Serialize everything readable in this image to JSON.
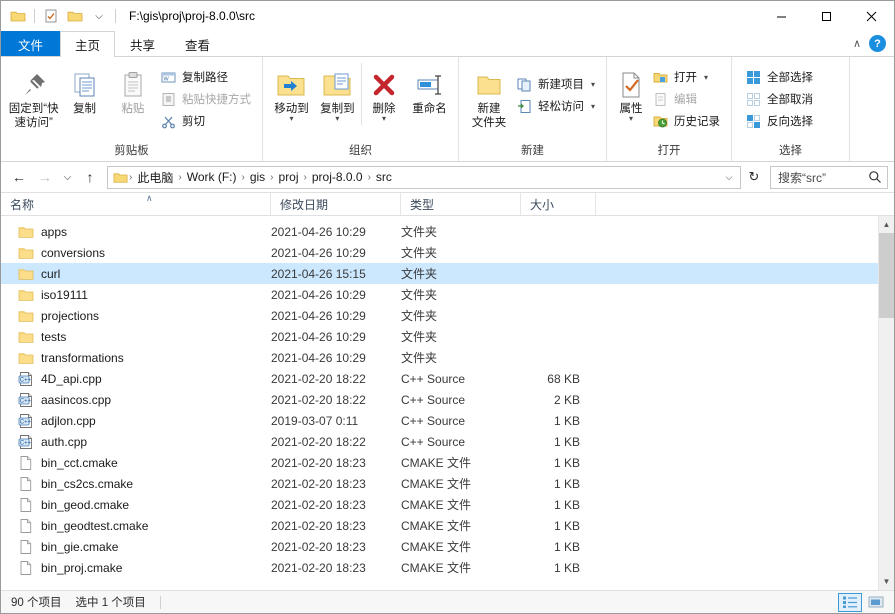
{
  "window": {
    "title": "F:\\gis\\proj\\proj-8.0.0\\src",
    "minimize_label": "—",
    "maximize_label": "☐",
    "close_label": "✕"
  },
  "quick_access": {
    "folder_icon": "folder-icon",
    "properties_icon": "properties-icon",
    "new_folder_icon": "new-folder-icon",
    "dropdown_label": "⌵"
  },
  "ribbon": {
    "tabs": [
      {
        "label": "文件",
        "kind": "file"
      },
      {
        "label": "主页",
        "kind": "active"
      },
      {
        "label": "共享",
        "kind": "normal"
      },
      {
        "label": "查看",
        "kind": "normal"
      }
    ],
    "collapse_label": "∧",
    "help_label": "?",
    "groups": {
      "clipboard": {
        "title": "剪贴板",
        "pin": "固定到“快速访问”",
        "copy": "复制",
        "paste": "粘贴",
        "copy_path": "复制路径",
        "paste_shortcut": "粘贴快捷方式",
        "cut": "剪切"
      },
      "organize": {
        "title": "组织",
        "move_to": "移动到",
        "copy_to": "复制到",
        "delete": "删除",
        "rename": "重命名"
      },
      "new": {
        "title": "新建",
        "new_folder_line1": "新建",
        "new_folder_line2": "文件夹",
        "new_item": "新建项目",
        "easy_access": "轻松访问"
      },
      "open": {
        "title": "打开",
        "properties": "属性",
        "open": "打开",
        "edit": "编辑",
        "history": "历史记录"
      },
      "select": {
        "title": "选择",
        "select_all": "全部选择",
        "select_none": "全部取消",
        "invert": "反向选择"
      }
    }
  },
  "nav": {
    "back": "←",
    "forward": "→",
    "recent": "⌵",
    "up": "↑",
    "refresh": "↻",
    "dropdown": "⌵"
  },
  "breadcrumb": {
    "separator": "›",
    "items": [
      "此电脑",
      "Work (F:)",
      "gis",
      "proj",
      "proj-8.0.0",
      "src"
    ]
  },
  "search": {
    "placeholder": "搜索“src”",
    "icon": "search-icon"
  },
  "columns": {
    "name": "名称",
    "date": "修改日期",
    "type": "类型",
    "size": "大小",
    "sort_marker": "∧"
  },
  "files": [
    {
      "name": "apps",
      "date": "2021-04-26 10:29",
      "type": "文件夹",
      "size": "",
      "icon": "folder-icon",
      "selected": false
    },
    {
      "name": "conversions",
      "date": "2021-04-26 10:29",
      "type": "文件夹",
      "size": "",
      "icon": "folder-icon",
      "selected": false
    },
    {
      "name": "curl",
      "date": "2021-04-26 15:15",
      "type": "文件夹",
      "size": "",
      "icon": "folder-icon",
      "selected": true
    },
    {
      "name": "iso19111",
      "date": "2021-04-26 10:29",
      "type": "文件夹",
      "size": "",
      "icon": "folder-icon",
      "selected": false
    },
    {
      "name": "projections",
      "date": "2021-04-26 10:29",
      "type": "文件夹",
      "size": "",
      "icon": "folder-icon",
      "selected": false
    },
    {
      "name": "tests",
      "date": "2021-04-26 10:29",
      "type": "文件夹",
      "size": "",
      "icon": "folder-icon",
      "selected": false
    },
    {
      "name": "transformations",
      "date": "2021-04-26 10:29",
      "type": "文件夹",
      "size": "",
      "icon": "folder-icon",
      "selected": false
    },
    {
      "name": "4D_api.cpp",
      "date": "2021-02-20 18:22",
      "type": "C++ Source",
      "size": "68 KB",
      "icon": "cpp-source-icon",
      "selected": false
    },
    {
      "name": "aasincos.cpp",
      "date": "2021-02-20 18:22",
      "type": "C++ Source",
      "size": "2 KB",
      "icon": "cpp-source-icon",
      "selected": false
    },
    {
      "name": "adjlon.cpp",
      "date": "2019-03-07 0:11",
      "type": "C++ Source",
      "size": "1 KB",
      "icon": "cpp-source-icon",
      "selected": false
    },
    {
      "name": "auth.cpp",
      "date": "2021-02-20 18:22",
      "type": "C++ Source",
      "size": "1 KB",
      "icon": "cpp-source-icon",
      "selected": false
    },
    {
      "name": "bin_cct.cmake",
      "date": "2021-02-20 18:23",
      "type": "CMAKE 文件",
      "size": "1 KB",
      "icon": "generic-file-icon",
      "selected": false
    },
    {
      "name": "bin_cs2cs.cmake",
      "date": "2021-02-20 18:23",
      "type": "CMAKE 文件",
      "size": "1 KB",
      "icon": "generic-file-icon",
      "selected": false
    },
    {
      "name": "bin_geod.cmake",
      "date": "2021-02-20 18:23",
      "type": "CMAKE 文件",
      "size": "1 KB",
      "icon": "generic-file-icon",
      "selected": false
    },
    {
      "name": "bin_geodtest.cmake",
      "date": "2021-02-20 18:23",
      "type": "CMAKE 文件",
      "size": "1 KB",
      "icon": "generic-file-icon",
      "selected": false
    },
    {
      "name": "bin_gie.cmake",
      "date": "2021-02-20 18:23",
      "type": "CMAKE 文件",
      "size": "1 KB",
      "icon": "generic-file-icon",
      "selected": false
    },
    {
      "name": "bin_proj.cmake",
      "date": "2021-02-20 18:23",
      "type": "CMAKE 文件",
      "size": "1 KB",
      "icon": "generic-file-icon",
      "selected": false
    }
  ],
  "status": {
    "item_count": "90 个项目",
    "selection": "选中 1 个项目",
    "details_view_icon": "details-view-icon",
    "large_icons_view_icon": "large-icons-view-icon"
  },
  "colors": {
    "accent": "#0078d7",
    "selection": "#cce8ff",
    "folder": "#ffd96b",
    "delete_red": "#c4262e"
  }
}
